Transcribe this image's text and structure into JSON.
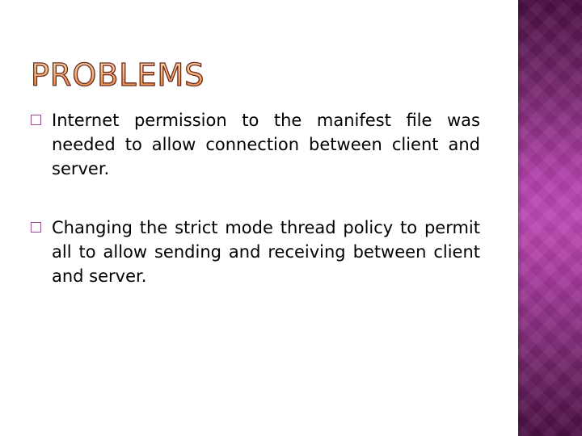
{
  "slide": {
    "title": "PROBLEMS",
    "bullets": [
      {
        "icon": "hollow-square-bullet",
        "text": "Internet permission to the manifest file was needed to allow connection between client and server."
      },
      {
        "icon": "hollow-square-bullet",
        "text": "Changing the strict mode thread policy to permit all to allow sending and receiving between client and server."
      }
    ]
  },
  "theme": {
    "accent_panel_color": "#b040a8",
    "bullet_color": "#9c4f96",
    "title_fill": "#f6b77c",
    "title_outline": "#6b2b22"
  }
}
